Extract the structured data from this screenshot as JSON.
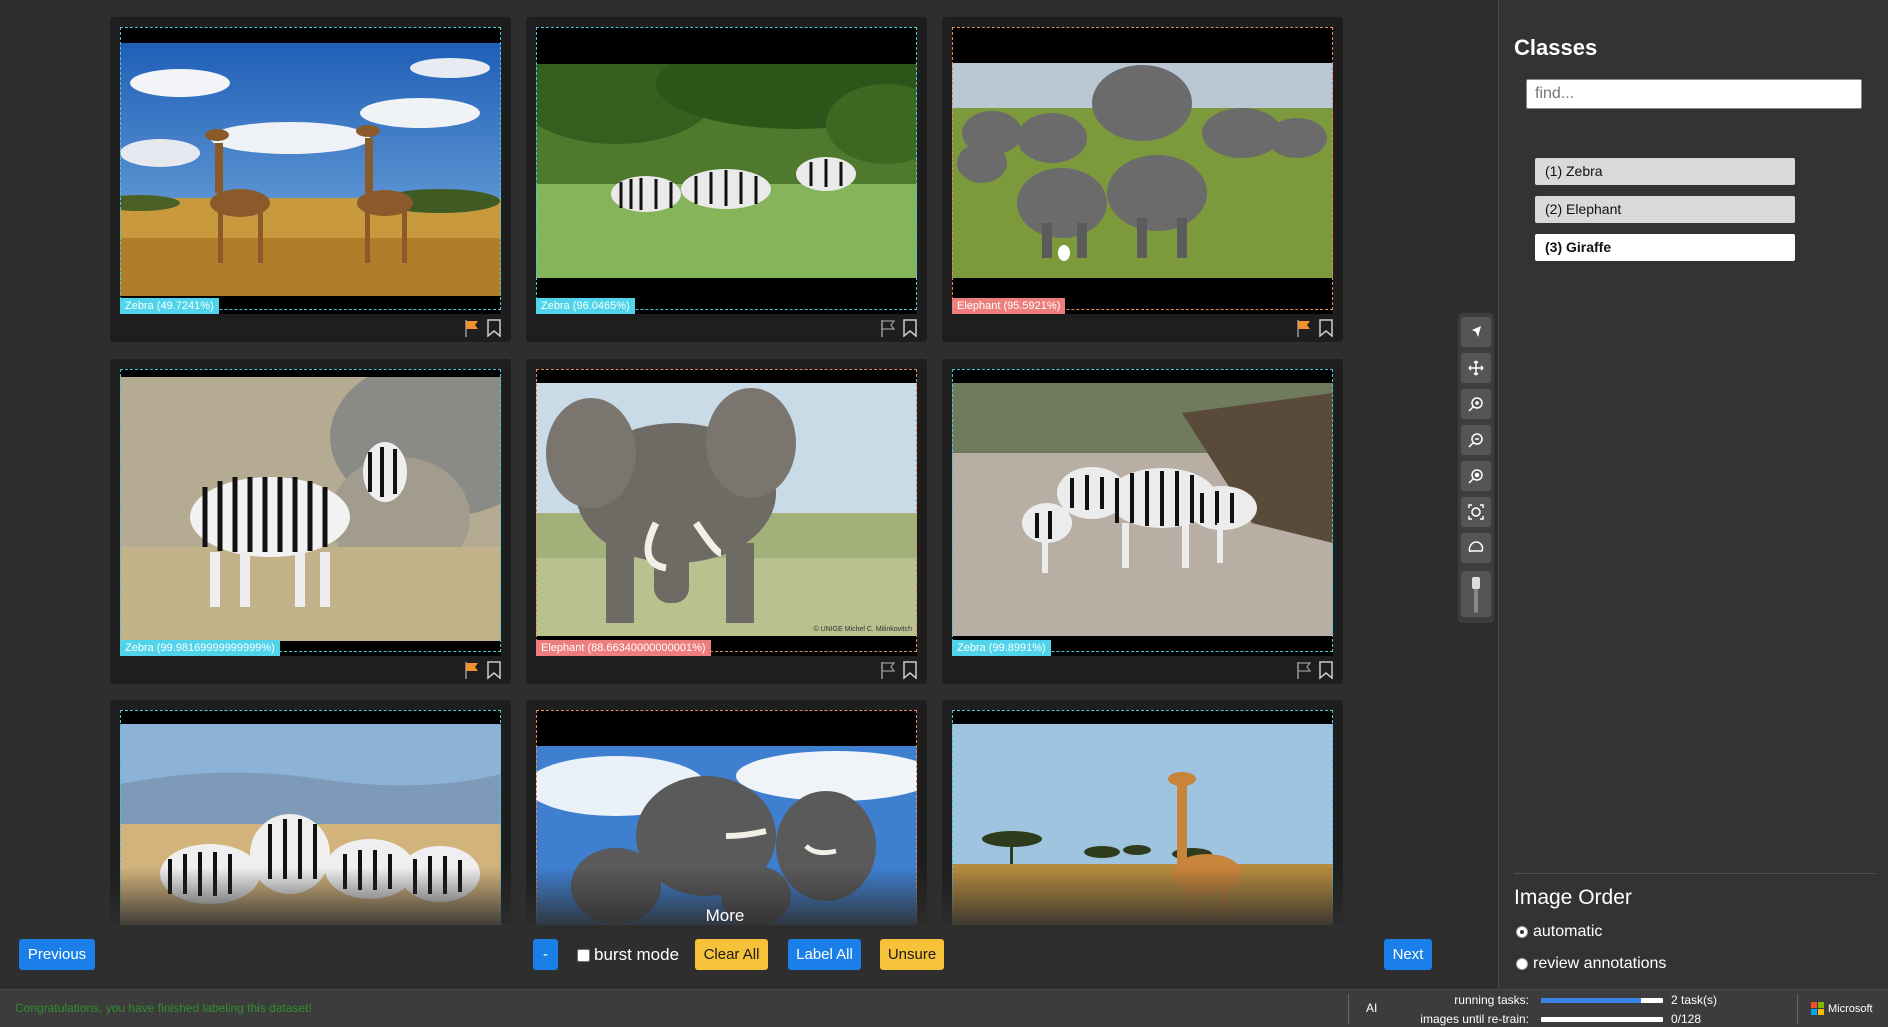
{
  "grid": {
    "cards": [
      {
        "label": "Zebra (49.7241%)",
        "cls": "zebra",
        "flagged": true
      },
      {
        "label": "Zebra (96.0465%)",
        "cls": "zebra",
        "flagged": false
      },
      {
        "label": "Elephant (95.5921%)",
        "cls": "elephant",
        "flagged": true
      },
      {
        "label": "Zebra (99.98169999999999%)",
        "cls": "zebra",
        "flagged": true
      },
      {
        "label": "Elephant (88.66340000000001%)",
        "cls": "elephant",
        "flagged": false
      },
      {
        "label": "Zebra (99.8991%)",
        "cls": "zebra",
        "flagged": false
      },
      {
        "label": "",
        "cls": "zebra",
        "flagged": false
      },
      {
        "label": "",
        "cls": "elephant",
        "flagged": false
      },
      {
        "label": "",
        "cls": "zebra",
        "flagged": false
      }
    ],
    "watermark_text": "© UNIGE Michel C. Milinkovitch",
    "more_label": "More"
  },
  "controls": {
    "previous": "Previous",
    "minus": "-",
    "burst_mode": "burst mode",
    "clear_all": "Clear All",
    "label_all": "Label All",
    "unsure": "Unsure",
    "next": "Next"
  },
  "panel": {
    "classes_title": "Classes",
    "find_placeholder": "find...",
    "classes": [
      "(1) Zebra",
      "(2) Elephant",
      "(3) Giraffe"
    ],
    "active_class": "(3) Giraffe",
    "image_order_title": "Image Order",
    "order_options": [
      "automatic",
      "review annotations"
    ],
    "selected_order": "automatic"
  },
  "status": {
    "message": "Congratulations, you have finished labeling this dataset!",
    "ai_label": "AI",
    "running_tasks_label": "running tasks:",
    "running_tasks_value": "2 task(s)",
    "running_tasks_progress": 0.82,
    "retrain_label": "images until re-train:",
    "retrain_value": "0/128",
    "retrain_progress": 0,
    "brand": "Microsoft"
  },
  "colors": {
    "zebra": "#4fd4ec",
    "elephant": "#ee7e7e",
    "button_blue": "#1a7fe8",
    "button_yellow": "#f5c23a",
    "flag_orange": "#f0922b"
  },
  "tools": [
    "select-arrow-icon",
    "move-icon",
    "zoom-in-icon",
    "zoom-out-icon",
    "zoom-reset-icon",
    "zoom-fit-icon",
    "lasso-icon",
    "brush-slider"
  ]
}
